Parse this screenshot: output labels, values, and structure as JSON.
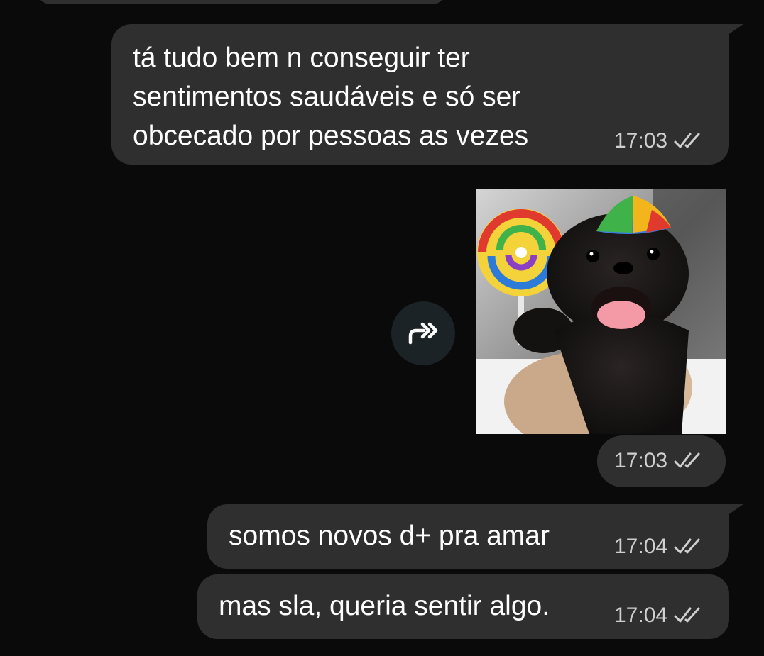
{
  "messages": [
    {
      "text": "tá tudo bem n conseguir ter\nsentimentos saudáveis e só ser\nobcecado por pessoas as vezes",
      "time": "17:03",
      "status": "read-double-check"
    },
    {
      "type": "sticker",
      "sticker_description_icon": "pug-with-lollipop-sticker",
      "time": "17:03",
      "status": "read-double-check"
    },
    {
      "text": "somos novos d+ pra amar",
      "time": "17:04",
      "status": "read-double-check"
    },
    {
      "text": "mas sla, queria sentir algo.",
      "time": "17:04",
      "status": "read-double-check"
    }
  ],
  "icons": {
    "forward": "forward-arrow-icon",
    "ticks": "double-check-icon"
  },
  "colors": {
    "background": "#0a0a0a",
    "bubble": "#2f2f2f",
    "text": "#ffffff",
    "meta": "#cfcfcf",
    "forward_button": "#1b2326"
  }
}
